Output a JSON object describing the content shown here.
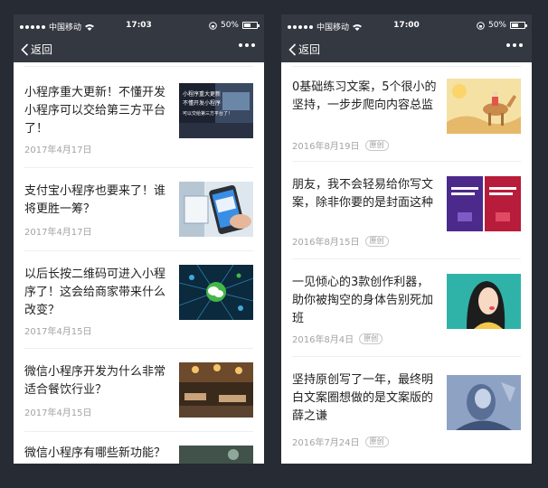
{
  "left_phone": {
    "status": {
      "carrier": "中国移动",
      "time": "17:03",
      "battery": "50%",
      "battery_level": 0.5
    },
    "nav": {
      "back_label": "返回"
    },
    "articles": [
      {
        "title": "小程序重大更新！不懂开发小程序可以交给第三方平台了！",
        "date": "2017年4月17日",
        "thumb_text": [
          "小程序重大更新",
          "不懂开发小程序",
          "可以交给第三方平台了！"
        ]
      },
      {
        "title": "支付宝小程序也要来了！谁将更胜一筹？",
        "date": "2017年4月17日"
      },
      {
        "title": "以后长按二维码可进入小程序了！这会给商家带来什么改变？",
        "date": "2017年4月15日"
      },
      {
        "title": "微信小程序开发为什么非常适合餐饮行业？",
        "date": "2017年4月15日"
      },
      {
        "title": "微信小程序有哪些新功能？",
        "date": ""
      }
    ]
  },
  "right_phone": {
    "status": {
      "carrier": "中国移动",
      "time": "17:00",
      "battery": "50%",
      "battery_level": 0.5
    },
    "nav": {
      "back_label": "返回"
    },
    "articles": [
      {
        "title": "0基础练习文案，5个很小的坚持，一步步爬向内容总监",
        "date": "2016年8月19日",
        "badge": "原创"
      },
      {
        "title": "朋友，我不会轻易给你写文案，除非你要的是封面这种",
        "date": "2016年8月15日",
        "badge": "原创"
      },
      {
        "title": "一见倾心的3款创作利器，助你被掏空的身体告别死加班",
        "date": "2016年8月4日",
        "badge": "原创"
      },
      {
        "title": "坚持原创写了一年，最终明白文案圈想做的是文案版的薛之谦",
        "date": "2016年7月24日",
        "badge": "原创"
      }
    ]
  },
  "colors": {
    "nav_bg": "#343841",
    "page_bg": "#272b34",
    "title_text": "#222222",
    "date_text": "#a3a3a3"
  }
}
